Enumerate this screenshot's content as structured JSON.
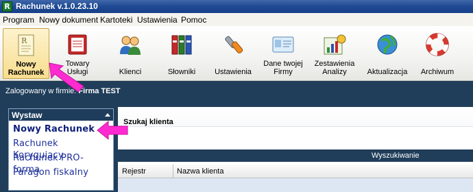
{
  "window": {
    "title": "Rachunek v.1.0.23.10",
    "icon_letter": "R"
  },
  "menu": [
    {
      "label": "Program"
    },
    {
      "label": "Nowy dokument"
    },
    {
      "label": "Kartoteki"
    },
    {
      "label": "Ustawienia"
    },
    {
      "label": "Pomoc"
    }
  ],
  "toolbar": [
    {
      "line1": "Nowy",
      "line2": "Rachunek",
      "icon": "new-invoice-icon",
      "active": true
    },
    {
      "line1": "Towary",
      "line2": "Usługi",
      "icon": "products-icon"
    },
    {
      "line1": "Klienci",
      "line2": "",
      "icon": "clients-icon"
    },
    {
      "line1": "Słowniki",
      "line2": "",
      "icon": "dictionaries-icon"
    },
    {
      "line1": "Ustawienia",
      "line2": "",
      "icon": "settings-icon"
    },
    {
      "line1": "Dane twojej",
      "line2": "Firmy",
      "icon": "company-data-icon"
    },
    {
      "line1": "Zestawienia",
      "line2": "Analizy",
      "icon": "reports-icon"
    },
    {
      "line1": "Aktualizacja",
      "line2": "",
      "icon": "update-icon"
    },
    {
      "line1": "Archiwum",
      "line2": "",
      "icon": "archive-icon"
    }
  ],
  "status": {
    "logged_prefix": "Zalogowany w firmie:",
    "company": "Firma TEST"
  },
  "wystaw": {
    "title": "Wystaw",
    "items": [
      {
        "label": "Nowy Rachunek",
        "selected": true
      },
      {
        "label": "Rachunek Korygujący"
      },
      {
        "label": "Rachunek PRO-forma"
      },
      {
        "label": "Paragon fiskalny"
      }
    ]
  },
  "search": {
    "title": "Szukaj klienta",
    "section": "Wyszukiwanie"
  },
  "table": {
    "columns": [
      "Rejestr",
      "Nazwa klienta"
    ]
  },
  "colors": {
    "titlebar": "#1f4a93",
    "panel_dark": "#203e5a",
    "pointer": "#ff2bd1"
  }
}
